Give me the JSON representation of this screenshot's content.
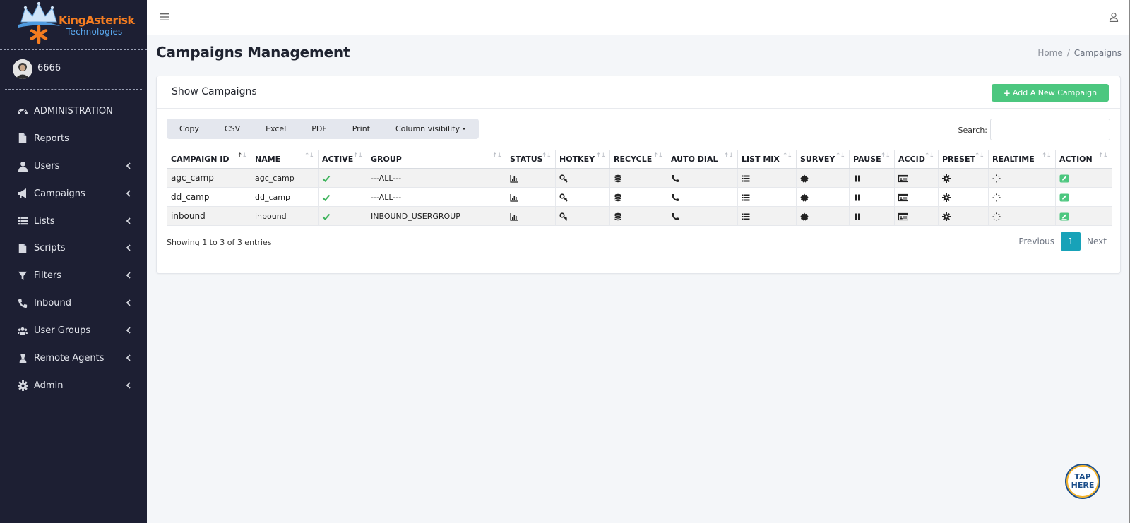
{
  "brand": {
    "name": "KingAsterisk",
    "sub": "Technologies"
  },
  "user": {
    "name": "6666"
  },
  "sidebar": {
    "items": [
      {
        "label": "ADMINISTRATION",
        "icon": "dashboard-icon",
        "has_chevron": false
      },
      {
        "label": "Reports",
        "icon": "file-icon",
        "has_chevron": false
      },
      {
        "label": "Users",
        "icon": "user-icon",
        "has_chevron": true
      },
      {
        "label": "Campaigns",
        "icon": "megaphone-icon",
        "has_chevron": true
      },
      {
        "label": "Lists",
        "icon": "list-icon",
        "has_chevron": true
      },
      {
        "label": "Scripts",
        "icon": "file-icon",
        "has_chevron": true
      },
      {
        "label": "Filters",
        "icon": "filter-icon",
        "has_chevron": true
      },
      {
        "label": "Inbound",
        "icon": "phone-icon",
        "has_chevron": true
      },
      {
        "label": "User Groups",
        "icon": "users-icon",
        "has_chevron": true
      },
      {
        "label": "Remote Agents",
        "icon": "agent-icon",
        "has_chevron": true
      },
      {
        "label": "Admin",
        "icon": "gear-icon",
        "has_chevron": true
      }
    ]
  },
  "header": {
    "title": "Campaigns Management",
    "breadcrumb": [
      "Home",
      "Campaigns"
    ]
  },
  "card": {
    "title": "Show Campaigns",
    "add_button": "Add A New Campaign",
    "export_buttons": [
      "Copy",
      "CSV",
      "Excel",
      "PDF",
      "Print"
    ],
    "column_visibility": "Column visibility",
    "search_label": "Search:",
    "search_value": ""
  },
  "table": {
    "columns": [
      "CAMPAIGN ID",
      "NAME",
      "ACTIVE",
      "GROUP",
      "STATUS",
      "HOTKEY",
      "RECYCLE",
      "AUTO DIAL",
      "LIST MIX",
      "SURVEY",
      "PAUSE",
      "ACCID",
      "PRESET",
      "REALTIME",
      "ACTION"
    ],
    "rows": [
      {
        "id": "agc_camp",
        "name": "agc_camp",
        "group": "---ALL---"
      },
      {
        "id": "dd_camp",
        "name": "dd_camp",
        "group": "---ALL---"
      },
      {
        "id": "inbound",
        "name": "inbound",
        "group": "INBOUND_USERGROUP"
      }
    ],
    "info": "Showing 1 to 3 of 3 entries",
    "pager": {
      "previous": "Previous",
      "current": "1",
      "next": "Next"
    }
  },
  "tap_here": {
    "line1": "TAP",
    "line2": "HERE"
  },
  "colors": {
    "sidebar_bg": "#1d1f33",
    "accent_green": "#4cc77f",
    "pager_active": "#17a2b8",
    "brand_orange": "#f47c20",
    "brand_blue": "#5aa9f0"
  }
}
